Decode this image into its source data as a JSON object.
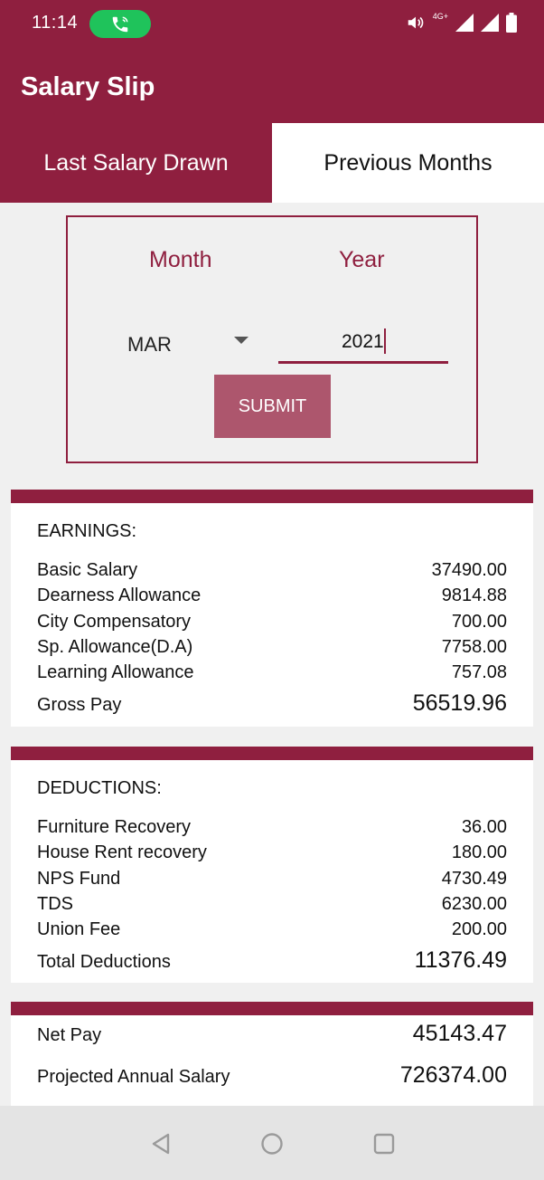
{
  "status": {
    "time": "11:14",
    "network_label": "4G+"
  },
  "app": {
    "title": "Salary Slip",
    "accent_color": "#8f1f3f"
  },
  "tabs": [
    {
      "label": "Last Salary Drawn",
      "active": true
    },
    {
      "label": "Previous Months",
      "active": false
    }
  ],
  "filter": {
    "month_label": "Month",
    "year_label": "Year",
    "month_value": "MAR",
    "year_value": "2021",
    "submit_label": "SUBMIT"
  },
  "earnings": {
    "heading": "EARNINGS:",
    "items": [
      {
        "label": "Basic Salary",
        "amount": "37490.00"
      },
      {
        "label": "Dearness Allowance",
        "amount": "9814.88"
      },
      {
        "label": "City Compensatory",
        "amount": "700.00"
      },
      {
        "label": "Sp. Allowance(D.A)",
        "amount": "7758.00"
      },
      {
        "label": "Learning Allowance",
        "amount": "757.08"
      }
    ],
    "total_label": "Gross Pay",
    "total_amount": "56519.96"
  },
  "deductions": {
    "heading": "DEDUCTIONS:",
    "items": [
      {
        "label": "Furniture Recovery",
        "amount": "36.00"
      },
      {
        "label": "House Rent recovery",
        "amount": "180.00"
      },
      {
        "label": "NPS Fund",
        "amount": "4730.49"
      },
      {
        "label": "TDS",
        "amount": "6230.00"
      },
      {
        "label": "Union Fee",
        "amount": "200.00"
      }
    ],
    "total_label": "Total Deductions",
    "total_amount": "11376.49"
  },
  "summary": {
    "net_pay_label": "Net Pay",
    "net_pay_amount": "45143.47",
    "projected_label": "Projected Annual Salary",
    "projected_amount": "726374.00"
  }
}
